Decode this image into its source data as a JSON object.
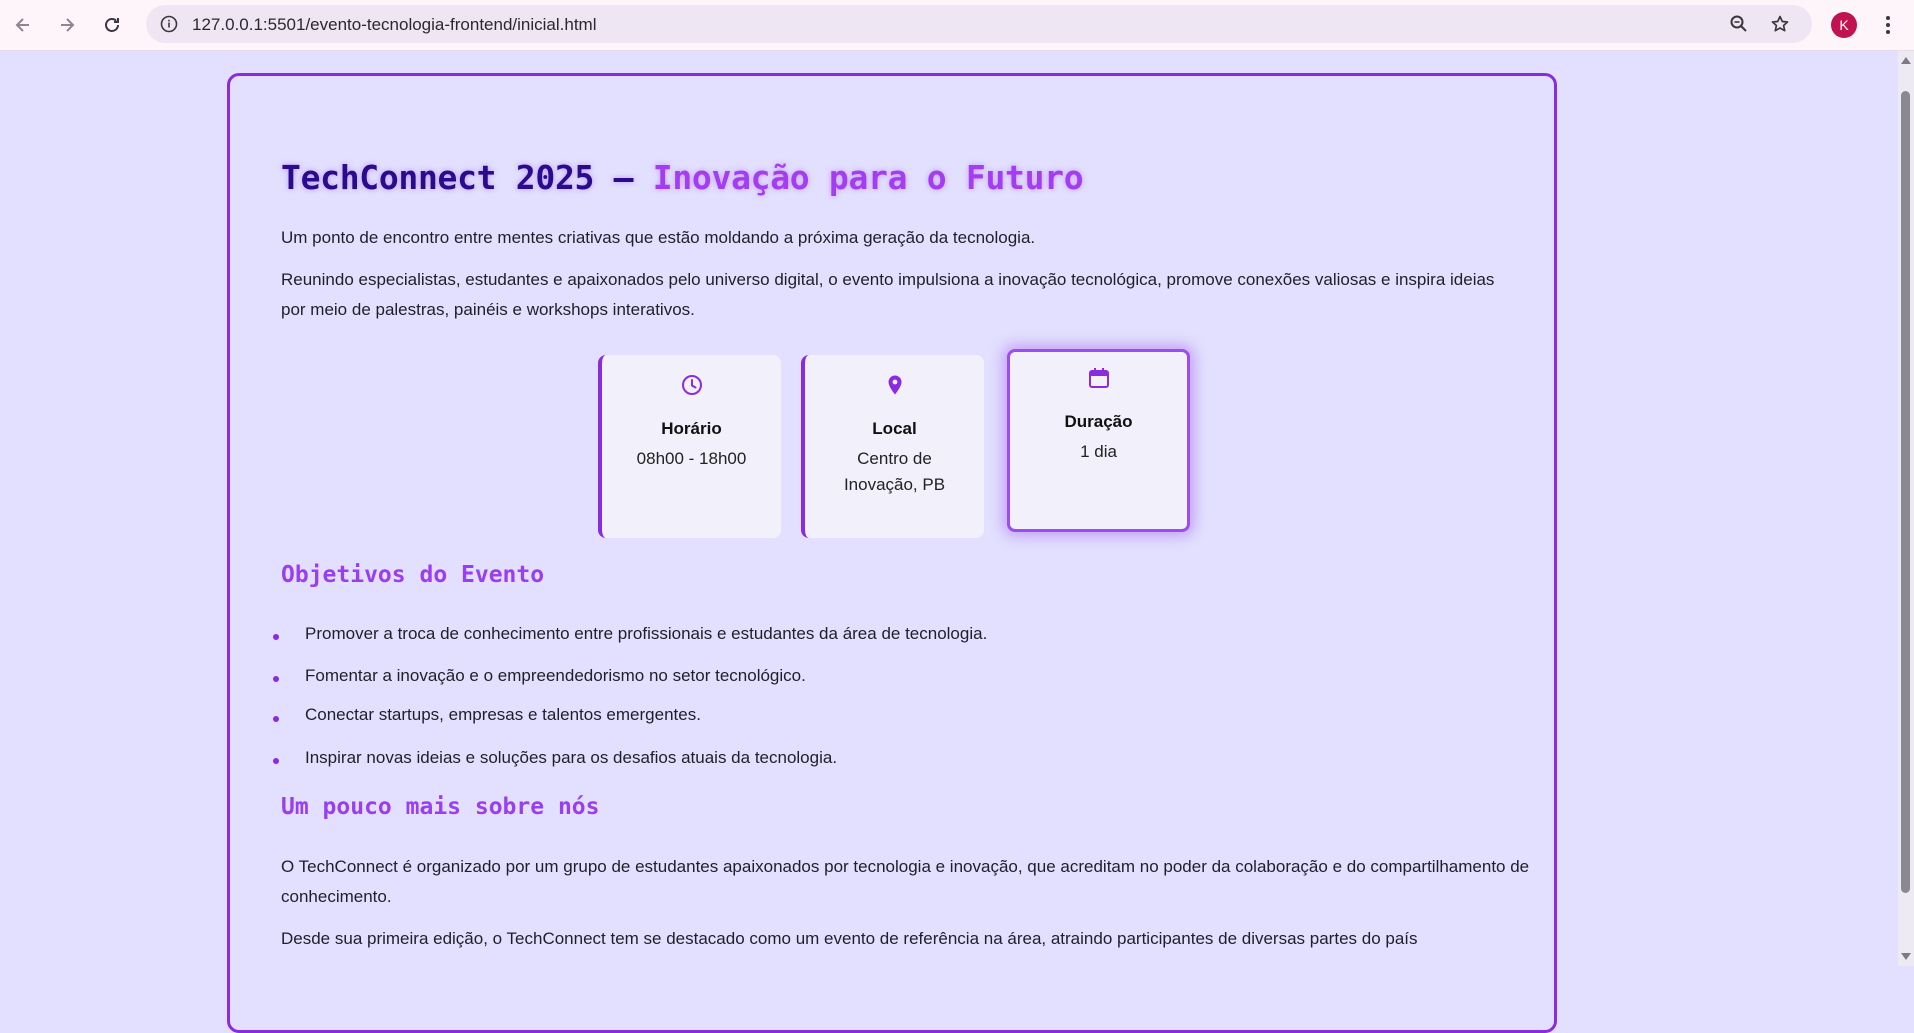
{
  "browser": {
    "url": "127.0.0.1:5501/evento-tecnologia-frontend/inicial.html",
    "profile_initial": "K",
    "icons": {
      "back": "arrow-left-icon",
      "forward": "arrow-right-icon",
      "reload": "reload-icon",
      "site_info": "info-icon",
      "zoom": "zoom-icon",
      "bookmark": "star-icon",
      "menu": "kebab-menu-icon"
    }
  },
  "colors": {
    "page_background": "#e2e0fe",
    "accent": "#8a2be2",
    "title_dark": "#2a0b8c",
    "title_light": "#a43df1",
    "profile": "#c0134f"
  },
  "page": {
    "title_part1": "TechConnect 2025 – ",
    "title_part2": "Inovação para o Futuro",
    "intro": "Um ponto de encontro entre mentes criativas que estão moldando a próxima geração da tecnologia.",
    "description": "Reunindo especialistas, estudantes e apaixonados pelo universo digital, o evento impulsiona a inovação tecnológica, promove conexões valiosas e inspira ideias por meio de palestras, painéis e workshops interativos.",
    "info_cards": [
      {
        "icon": "clock-icon",
        "title": "Horário",
        "value": "08h00 - 18h00"
      },
      {
        "icon": "location-pin-icon",
        "title": "Local",
        "value": "Centro de Inovação, PB"
      },
      {
        "icon": "calendar-icon",
        "title": "Duração",
        "value": "1 dia"
      }
    ],
    "objectives_heading": "Objetivos do Evento",
    "objectives": [
      "Promover a troca de conhecimento entre profissionais e estudantes da área de tecnologia.",
      "Fomentar a inovação e o empreendedorismo no setor tecnológico.",
      "Conectar startups, empresas e talentos emergentes.",
      "Inspirar novas ideias e soluções para os desafios atuais da tecnologia."
    ],
    "about_heading": "Um pouco mais sobre nós",
    "about_p1": "O TechConnect é organizado por um grupo de estudantes apaixonados por tecnologia e inovação, que acreditam no poder da colaboração e do compartilhamento de conhecimento.",
    "about_p2": "Desde sua primeira edição, o TechConnect tem se destacado como um evento de referência na área, atraindo participantes de diversas partes do país"
  }
}
